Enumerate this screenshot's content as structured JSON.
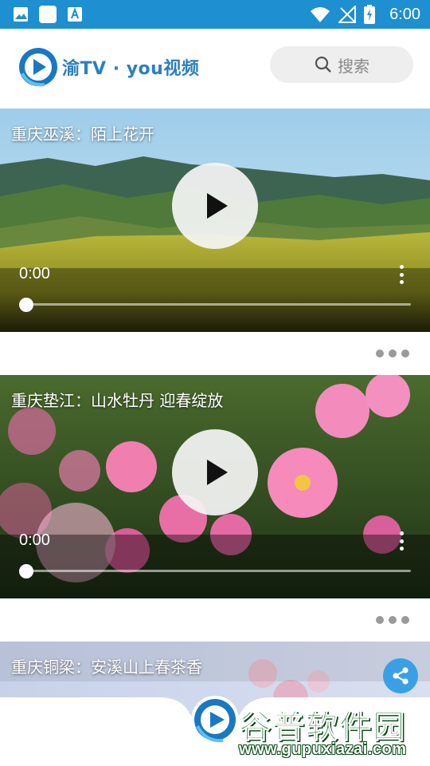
{
  "status_bar": {
    "time": "6:00",
    "icons": [
      "image-icon",
      "square-icon",
      "font-icon",
      "wifi-icon",
      "signal-off-icon",
      "battery-charging-icon"
    ],
    "background": "#1e8fd0"
  },
  "header": {
    "title": "渝TV · you视频",
    "search_label": "搜索",
    "brand_color": "#2b7fc1"
  },
  "videos": [
    {
      "title": "重庆巫溪：陌上花开",
      "time": "0:00",
      "progress": 0
    },
    {
      "title": "重庆垫江：山水牡丹 迎春绽放",
      "time": "0:00",
      "progress": 0
    },
    {
      "title": "重庆铜梁：安溪山上春茶香"
    }
  ],
  "watermark": {
    "main": "谷普软件园",
    "sub": "www.gupuxiazai.com"
  },
  "accent": "#3aa0e6"
}
